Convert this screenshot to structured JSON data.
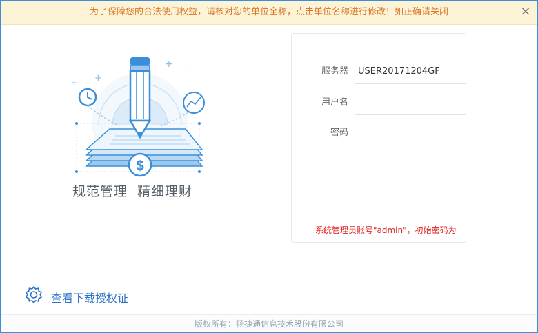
{
  "notice": {
    "text": "为了保障您的合法使用权益，请核对您的单位全称，点击单位名称进行修改！如正确请关闭",
    "close_glyph": "×"
  },
  "slogan": {
    "left": "规范管理",
    "right": "精细理财"
  },
  "login": {
    "server_label": "服务器",
    "server_value": "USER20171204GF",
    "username_label": "用户名",
    "username_value": "",
    "password_label": "密码",
    "password_value": "",
    "hint": "系统管理员账号\"admin\"，初始密码为"
  },
  "license": {
    "link_text": "查看下载授权证"
  },
  "footer": {
    "text": "版权所有：畅捷通信息技术股份有限公司"
  },
  "colors": {
    "accent": "#3b8fd9",
    "notice_text": "#d8782a",
    "hint_text": "#e02222",
    "link": "#2a71c7"
  },
  "icons": {
    "close": "close-icon",
    "illustration": "pencil-document-illustration",
    "license": "gear-badge-icon"
  }
}
